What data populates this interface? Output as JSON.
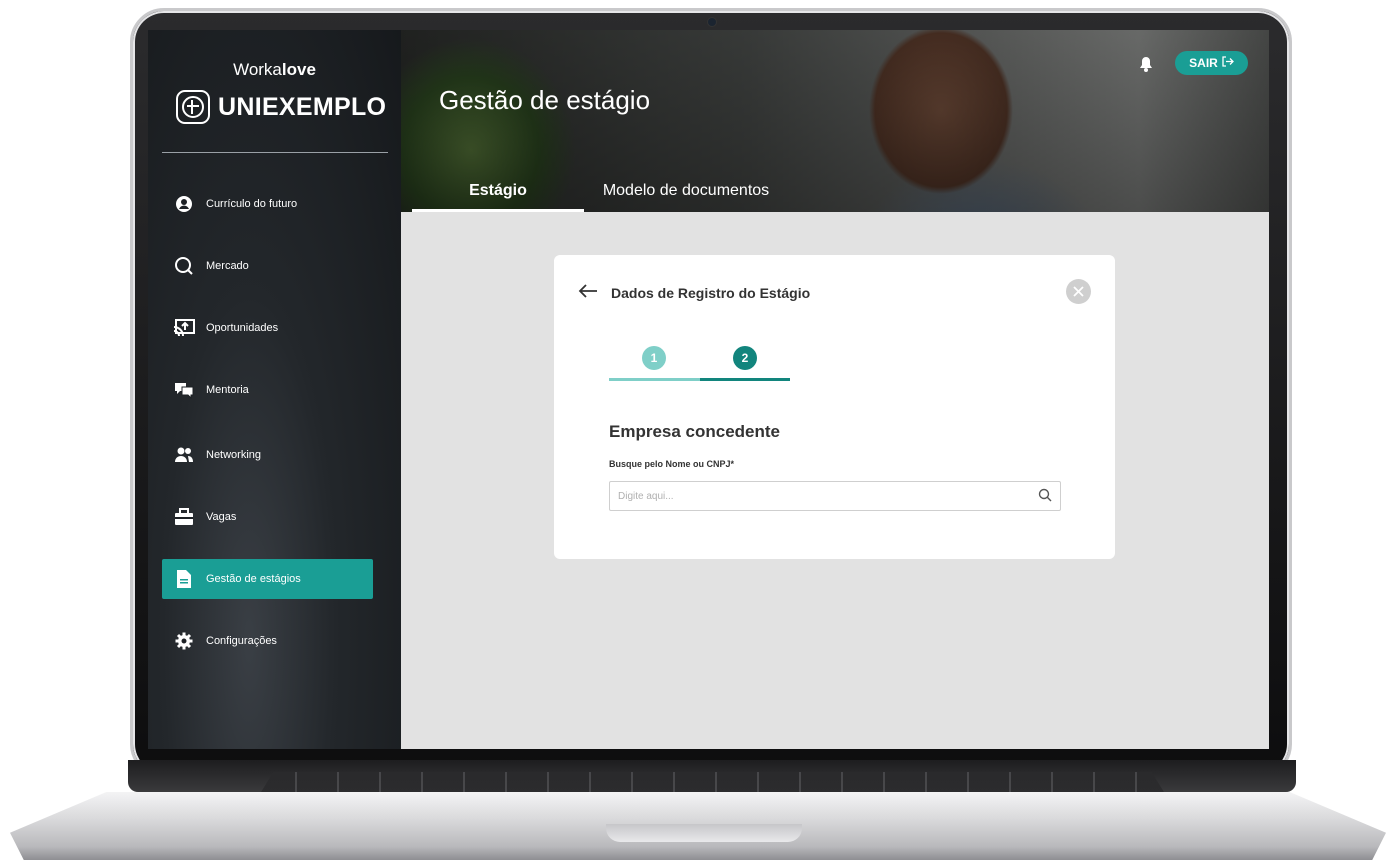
{
  "sidebar": {
    "brand_top_prefix": "Worka",
    "brand_top_suffix": "love",
    "brand_name": "UNIEXEMPLO",
    "items": [
      {
        "label": "Currículo do futuro",
        "icon": "user-circle-icon"
      },
      {
        "label": "Mercado",
        "icon": "search-icon"
      },
      {
        "label": "Oportunidades",
        "icon": "cast-icon"
      },
      {
        "label": "Mentoria",
        "icon": "chat-icon"
      },
      {
        "label": "Networking",
        "icon": "users-icon"
      },
      {
        "label": "Vagas",
        "icon": "briefcase-icon"
      },
      {
        "label": "Gestão de estágios",
        "icon": "document-icon",
        "active": true
      },
      {
        "label": "Configurações",
        "icon": "gear-icon"
      }
    ]
  },
  "header": {
    "title": "Gestão de estágio",
    "logout_label": "SAIR",
    "tabs": [
      {
        "label": "Estágio",
        "active": true
      },
      {
        "label": "Modelo de documentos",
        "active": false
      }
    ]
  },
  "card": {
    "title": "Dados de Registro do Estágio",
    "steps": [
      "1",
      "2"
    ],
    "current_step": 2,
    "section_title": "Empresa concedente",
    "field_label": "Busque pelo Nome ou CNPJ*",
    "search_placeholder": "Digite aqui...",
    "search_value": ""
  },
  "colors": {
    "accent": "#1a9e95",
    "step_done": "#7fcfc8",
    "step_current": "#12857d"
  }
}
